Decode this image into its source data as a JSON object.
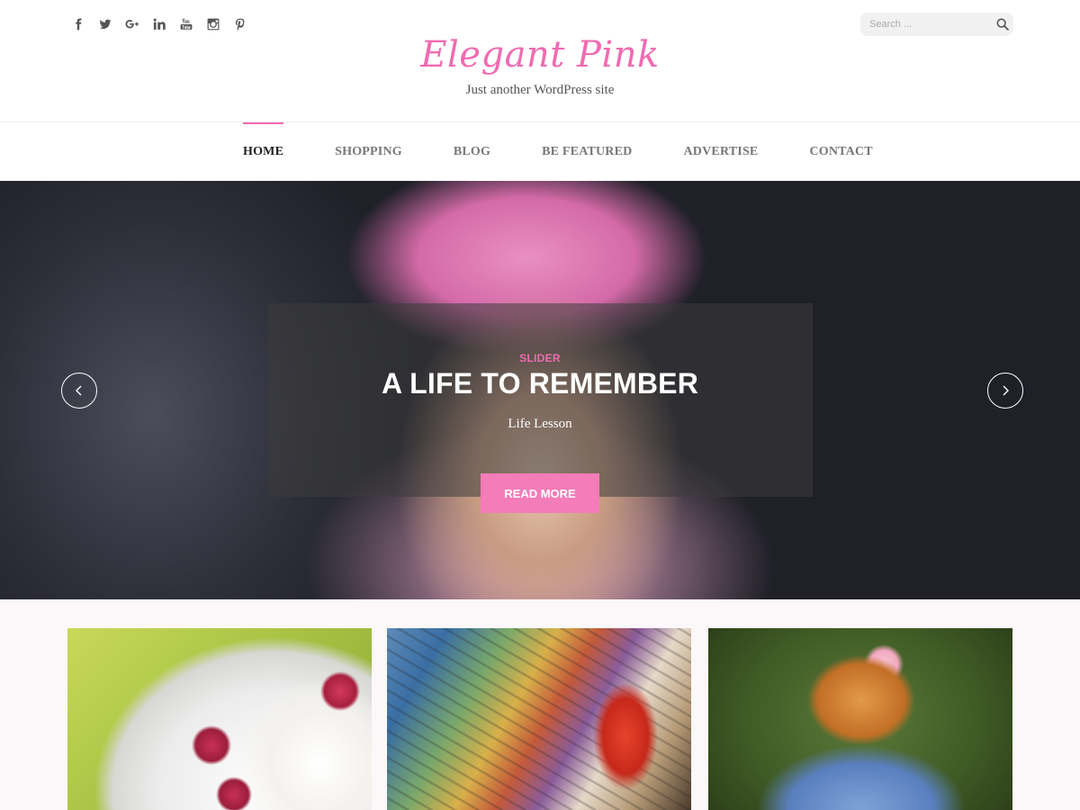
{
  "header": {
    "social_icons": [
      "facebook-icon",
      "twitter-icon",
      "google-plus-icon",
      "linkedin-icon",
      "youtube-icon",
      "instagram-icon",
      "pinterest-icon"
    ],
    "search_placeholder": "Search ...",
    "site_title": "Elegant Pink",
    "tagline": "Just another WordPress site"
  },
  "nav": {
    "items": [
      {
        "label": "HOME",
        "active": true
      },
      {
        "label": "SHOPPING",
        "active": false
      },
      {
        "label": "BLOG",
        "active": false
      },
      {
        "label": "BE FEATURED",
        "active": false
      },
      {
        "label": "ADVERTISE",
        "active": false
      },
      {
        "label": "CONTACT",
        "active": false
      }
    ]
  },
  "slider": {
    "category": "SLIDER",
    "title": "A LIFE TO REMEMBER",
    "subtitle": "Life Lesson",
    "button_label": "READ MORE"
  },
  "colors": {
    "accent": "#f06bb2",
    "button": "#f47cb8",
    "background_strip": "#fcf8f9"
  }
}
